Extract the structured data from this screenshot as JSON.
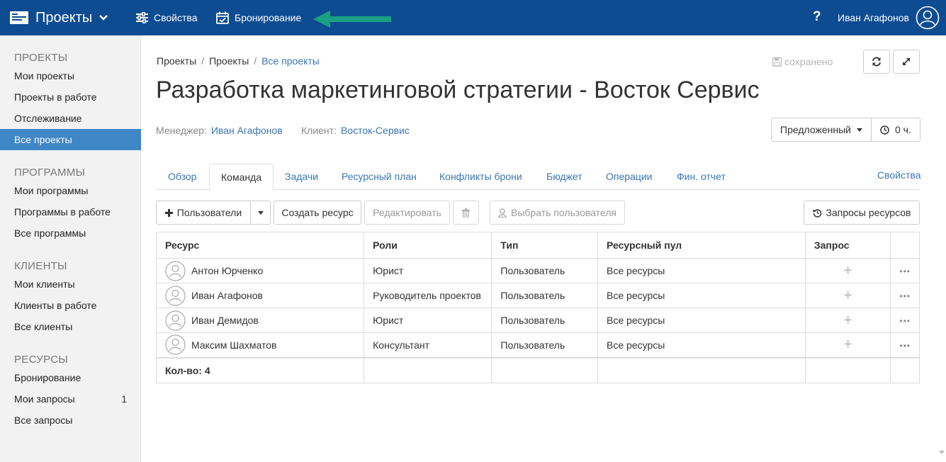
{
  "topbar": {
    "brand": "Проекты",
    "nav": [
      {
        "label": "Свойства",
        "icon": "sliders-icon"
      },
      {
        "label": "Бронирование",
        "icon": "calendar-check-icon"
      }
    ],
    "help": "?",
    "user": "Иван Агафонов",
    "accent": "#0e4c92"
  },
  "sidebar": {
    "sections": [
      {
        "title": "ПРОЕКТЫ",
        "items": [
          {
            "label": "Мои проекты"
          },
          {
            "label": "Проекты в работе"
          },
          {
            "label": "Отслеживание"
          },
          {
            "label": "Все проекты",
            "active": true
          }
        ]
      },
      {
        "title": "ПРОГРАММЫ",
        "items": [
          {
            "label": "Мои программы"
          },
          {
            "label": "Программы в работе"
          },
          {
            "label": "Все программы"
          }
        ]
      },
      {
        "title": "КЛИЕНТЫ",
        "items": [
          {
            "label": "Мои клиенты"
          },
          {
            "label": "Клиенты в работе"
          },
          {
            "label": "Все клиенты"
          }
        ]
      },
      {
        "title": "РЕСУРСЫ",
        "items": [
          {
            "label": "Бронирование"
          },
          {
            "label": "Мои запросы",
            "count": "1"
          },
          {
            "label": "Все запросы"
          }
        ]
      }
    ]
  },
  "breadcrumb": [
    "Проекты",
    "Проекты",
    "Все проекты"
  ],
  "saved": "сохранено",
  "title": "Разработка маркетинговой стратегии - Восток Сервис",
  "meta": {
    "manager_label": "Менеджер:",
    "manager": "Иван Агафонов",
    "client_label": "Клиент:",
    "client": "Восток-Сервис"
  },
  "status": {
    "value": "Предложенный",
    "hours": "0 ч."
  },
  "tabs": [
    "Обзор",
    "Команда",
    "Задачи",
    "Ресурсный план",
    "Конфликты брони",
    "Бюджет",
    "Операции",
    "Фин. отчет"
  ],
  "active_tab": "Команда",
  "tabs_right": "Свойства",
  "toolbar": {
    "users": "Пользователи",
    "create_resource": "Создать ресурс",
    "edit": "Редактировать",
    "pick_user": "Выбрать пользователя",
    "resource_requests": "Запросы ресурсов"
  },
  "table": {
    "columns": [
      "Ресурс",
      "Роли",
      "Тип",
      "Ресурсный пул",
      "Запрос",
      ""
    ],
    "rows": [
      {
        "name": "Антон Юрченко",
        "role": "Юрист",
        "type": "Пользователь",
        "pool": "Все ресурсы"
      },
      {
        "name": "Иван Агафонов",
        "role": "Руководитель проектов",
        "type": "Пользователь",
        "pool": "Все ресурсы"
      },
      {
        "name": "Иван Демидов",
        "role": "Юрист",
        "type": "Пользователь",
        "pool": "Все ресурсы"
      },
      {
        "name": "Максим Шахматов",
        "role": "Консультант",
        "type": "Пользователь",
        "pool": "Все ресурсы"
      }
    ],
    "footer": "Кол-во: 4"
  }
}
